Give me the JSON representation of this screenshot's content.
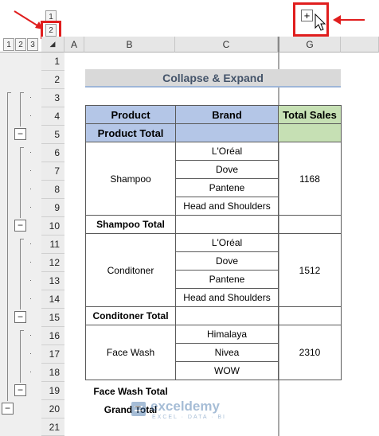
{
  "outline": {
    "row_level_buttons": [
      "1",
      "2"
    ],
    "col_level_buttons": [
      "1",
      "2",
      "3"
    ],
    "collapse_symbol": "−",
    "expand_symbol": "+"
  },
  "columns": [
    "A",
    "B",
    "C",
    "G"
  ],
  "rows": [
    "1",
    "2",
    "3",
    "4",
    "5",
    "6",
    "7",
    "8",
    "9",
    "10",
    "11",
    "12",
    "13",
    "14",
    "15",
    "16",
    "17",
    "18",
    "19",
    "20",
    "21"
  ],
  "sheet": {
    "title": "Collapse & Expand",
    "headers": {
      "product": "Product",
      "brand": "Brand",
      "sales": "Total Sales"
    },
    "product_total": "Product Total",
    "groups": [
      {
        "name": "Shampoo",
        "brands": [
          "L'Oréal",
          "Dove",
          "Pantene",
          "Head and Shoulders"
        ],
        "sales": "1168",
        "total_label": "Shampoo Total"
      },
      {
        "name": "Conditoner",
        "brands": [
          "L'Oréal",
          "Dove",
          "Pantene",
          "Head and Shoulders"
        ],
        "sales": "1512",
        "total_label": "Conditoner Total"
      },
      {
        "name": "Face Wash",
        "brands": [
          "Himalaya",
          "Nivea",
          "WOW"
        ],
        "sales": "2310",
        "total_label": "Face Wash Total"
      }
    ],
    "grand_total": "Grand Total"
  },
  "watermark": {
    "brand": "exceldemy",
    "tagline": "EXCEL · DATA · BI"
  },
  "colors": {
    "annotation_red": "#e01e1e",
    "header_blue": "#b4c6e7",
    "sales_green": "#c6e0b4",
    "title_band": "#d9d9d9"
  }
}
